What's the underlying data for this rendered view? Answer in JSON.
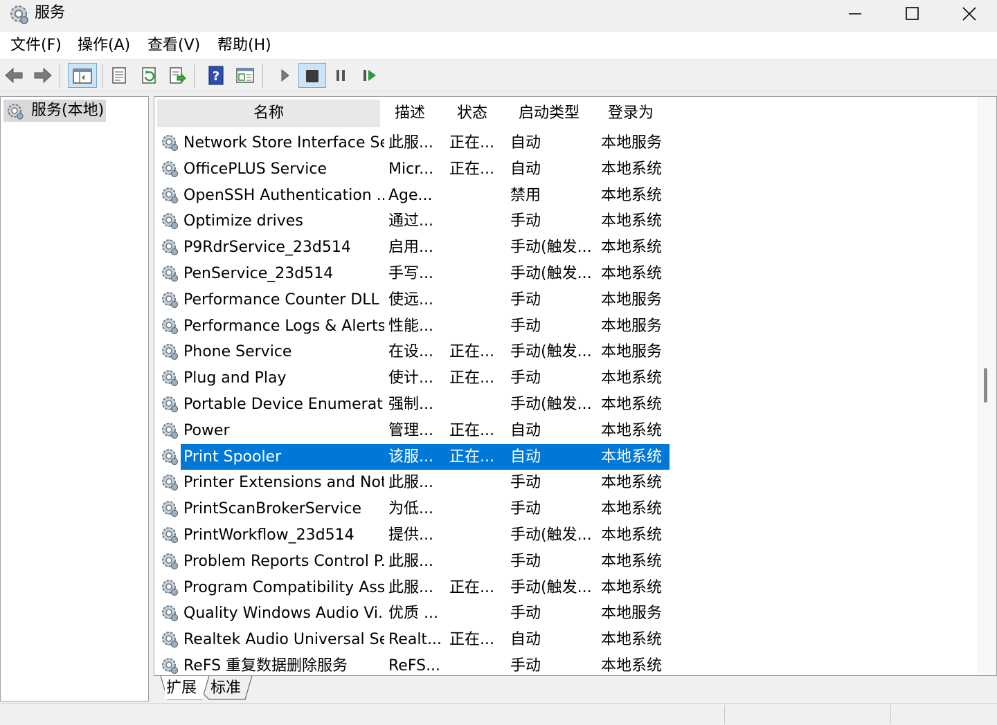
{
  "window": {
    "title": "服务",
    "icon": "gear-icon",
    "controls": [
      "minimize-icon",
      "maximize-icon",
      "close-icon"
    ]
  },
  "menu": [
    {
      "label": "文件(F)"
    },
    {
      "label": "操作(A)"
    },
    {
      "label": "查看(V)"
    },
    {
      "label": "帮助(H)"
    }
  ],
  "toolbar": {
    "icons": [
      "back-arrow-icon",
      "forward-arrow-icon",
      "console-tree-icon",
      "properties-icon",
      "refresh-icon",
      "export-list-icon",
      "help-icon",
      "view-icon",
      "start-service-icon",
      "stop-service-icon",
      "pause-service-icon",
      "restart-service-icon"
    ],
    "pressed": [
      "console-tree-icon",
      "stop-service-icon"
    ]
  },
  "tree": {
    "root_label": "服务(本地)"
  },
  "table": {
    "columns": [
      "名称",
      "描述",
      "状态",
      "启动类型",
      "登录为"
    ],
    "rows": [
      {
        "name": "Network Store Interface Se...",
        "desc": "此服...",
        "status": "正在...",
        "startup": "自动",
        "logon": "本地服务"
      },
      {
        "name": "OfficePLUS Service",
        "desc": "Micr...",
        "status": "正在...",
        "startup": "自动",
        "logon": "本地系统"
      },
      {
        "name": "OpenSSH Authentication ...",
        "desc": "Age...",
        "status": "",
        "startup": "禁用",
        "logon": "本地系统"
      },
      {
        "name": "Optimize drives",
        "desc": "通过...",
        "status": "",
        "startup": "手动",
        "logon": "本地系统"
      },
      {
        "name": "P9RdrService_23d514",
        "desc": "启用...",
        "status": "",
        "startup": "手动(触发...",
        "logon": "本地系统"
      },
      {
        "name": "PenService_23d514",
        "desc": "手写...",
        "status": "",
        "startup": "手动(触发...",
        "logon": "本地系统"
      },
      {
        "name": "Performance Counter DLL ...",
        "desc": "使远...",
        "status": "",
        "startup": "手动",
        "logon": "本地服务"
      },
      {
        "name": "Performance Logs & Alerts",
        "desc": "性能...",
        "status": "",
        "startup": "手动",
        "logon": "本地服务"
      },
      {
        "name": "Phone Service",
        "desc": "在设...",
        "status": "正在...",
        "startup": "手动(触发...",
        "logon": "本地服务"
      },
      {
        "name": "Plug and Play",
        "desc": "使计...",
        "status": "正在...",
        "startup": "手动",
        "logon": "本地系统"
      },
      {
        "name": "Portable Device Enumerat...",
        "desc": "强制...",
        "status": "",
        "startup": "手动(触发...",
        "logon": "本地系统"
      },
      {
        "name": "Power",
        "desc": "管理...",
        "status": "正在...",
        "startup": "自动",
        "logon": "本地系统"
      },
      {
        "name": "Print Spooler",
        "desc": "该服...",
        "status": "正在...",
        "startup": "自动",
        "logon": "本地系统",
        "selected": true
      },
      {
        "name": "Printer Extensions and Noti...",
        "desc": "此服...",
        "status": "",
        "startup": "手动",
        "logon": "本地系统"
      },
      {
        "name": "PrintScanBrokerService",
        "desc": "为低...",
        "status": "",
        "startup": "手动",
        "logon": "本地系统"
      },
      {
        "name": "PrintWorkflow_23d514",
        "desc": "提供...",
        "status": "",
        "startup": "手动(触发...",
        "logon": "本地系统"
      },
      {
        "name": "Problem Reports Control P...",
        "desc": "此服...",
        "status": "",
        "startup": "手动",
        "logon": "本地系统"
      },
      {
        "name": "Program Compatibility Assi...",
        "desc": "此服...",
        "status": "正在...",
        "startup": "手动(触发...",
        "logon": "本地系统"
      },
      {
        "name": "Quality Windows Audio Vi...",
        "desc": "优质 ...",
        "status": "",
        "startup": "手动",
        "logon": "本地服务"
      },
      {
        "name": "Realtek Audio Universal Se...",
        "desc": "Realt...",
        "status": "正在...",
        "startup": "自动",
        "logon": "本地系统"
      },
      {
        "name": "ReFS 重复数据删除服务",
        "desc": "ReFS...",
        "status": "",
        "startup": "手动",
        "logon": "本地系统"
      }
    ]
  },
  "tabs": [
    {
      "label": "扩展",
      "active": true
    },
    {
      "label": "标准",
      "active": false
    }
  ],
  "colors": {
    "selection": "#0078d7",
    "window_bg": "#f0f0f0",
    "pane_bg": "#ffffff"
  }
}
